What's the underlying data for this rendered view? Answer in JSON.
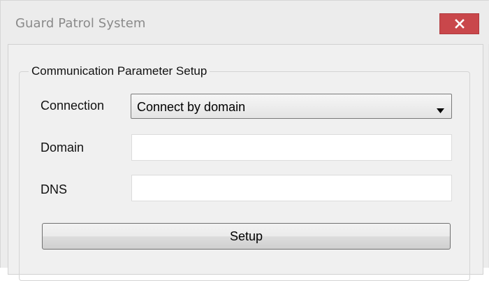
{
  "window": {
    "title": "Guard Patrol System",
    "close_icon": "close-icon",
    "close_color": "#c9474b"
  },
  "group": {
    "legend": "Communication Parameter Setup"
  },
  "form": {
    "connection_label": "Connection",
    "connection_value": "Connect by domain",
    "connection_arrow_icon": "dropdown-arrow-icon",
    "domain_label": "Domain",
    "domain_value": "",
    "dns_label": "DNS",
    "dns_value": ""
  },
  "actions": {
    "setup_label": "Setup"
  }
}
